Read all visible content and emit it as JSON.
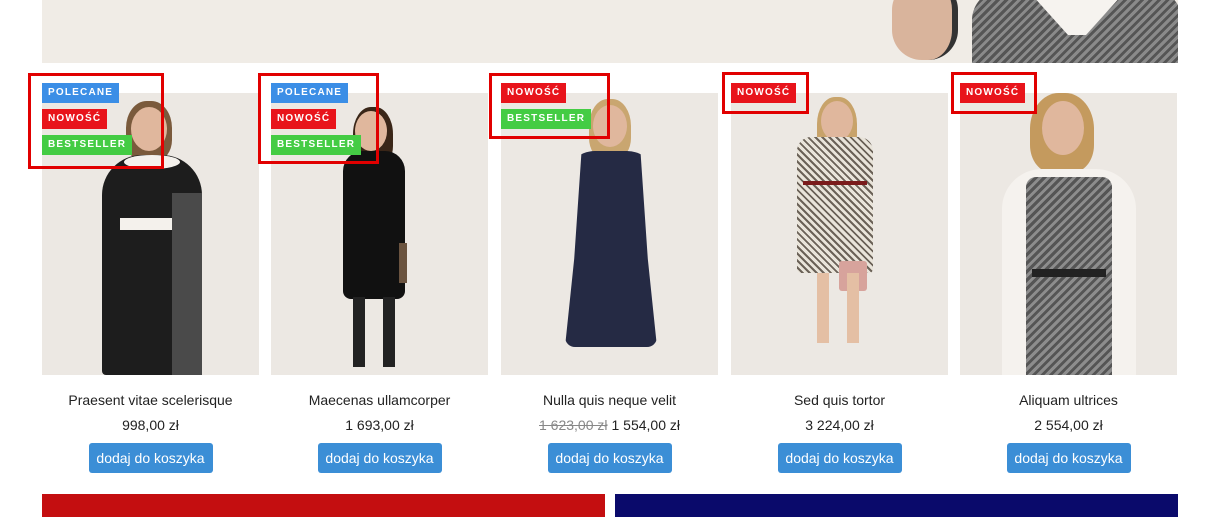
{
  "products": [
    {
      "name": "Praesent vitae scelerisque",
      "price": "998,00 zł",
      "old_price": "",
      "badges": [
        "POLECANE",
        "NOWOŚĆ",
        "BESTSELLER"
      ],
      "button": "dodaj do koszyka"
    },
    {
      "name": "Maecenas ullamcorper",
      "price": "1 693,00 zł",
      "old_price": "",
      "badges": [
        "POLECANE",
        "NOWOŚĆ",
        "BESTSELLER"
      ],
      "button": "dodaj do koszyka"
    },
    {
      "name": "Nulla quis neque velit",
      "price": "1 554,00 zł",
      "old_price": "1 623,00 zł",
      "badges": [
        "NOWOŚĆ",
        "BESTSELLER"
      ],
      "button": "dodaj do koszyka"
    },
    {
      "name": "Sed quis tortor",
      "price": "3 224,00 zł",
      "old_price": "",
      "badges": [
        "NOWOŚĆ"
      ],
      "button": "dodaj do koszyka"
    },
    {
      "name": "Aliquam ultrices",
      "price": "2 554,00 zł",
      "old_price": "",
      "badges": [
        "NOWOŚĆ"
      ],
      "button": "dodaj do koszyka"
    }
  ],
  "colors": {
    "badge_polecane": "#3b8ee6",
    "badge_nowosc": "#e8141b",
    "badge_bestseller": "#44cc44",
    "button": "#3b8ed6",
    "highlight_box": "#e10000",
    "banner_left": "#c40e10",
    "banner_right": "#0a0a6b"
  }
}
